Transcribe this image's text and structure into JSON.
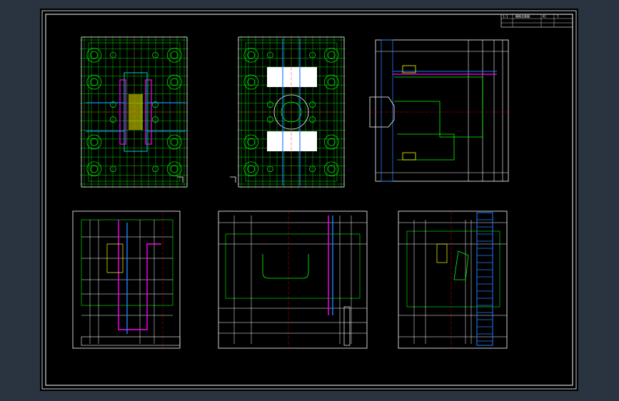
{
  "title_block": {
    "cells": [
      "1:1",
      "模具总装图",
      "A1",
      "1"
    ]
  },
  "views": [
    {
      "name": "moving-half-plan-view"
    },
    {
      "name": "fixed-half-plan-view"
    },
    {
      "name": "side-section-right"
    },
    {
      "name": "section-a-a"
    },
    {
      "name": "section-b-b"
    },
    {
      "name": "section-c-c"
    }
  ],
  "colors": {
    "outline": "#ffffff",
    "green": "#00ff00",
    "cyan": "#00ffff",
    "magenta": "#ff00ff",
    "red": "#ff0000",
    "blue": "#2080ff",
    "yellow": "#ffff00"
  }
}
